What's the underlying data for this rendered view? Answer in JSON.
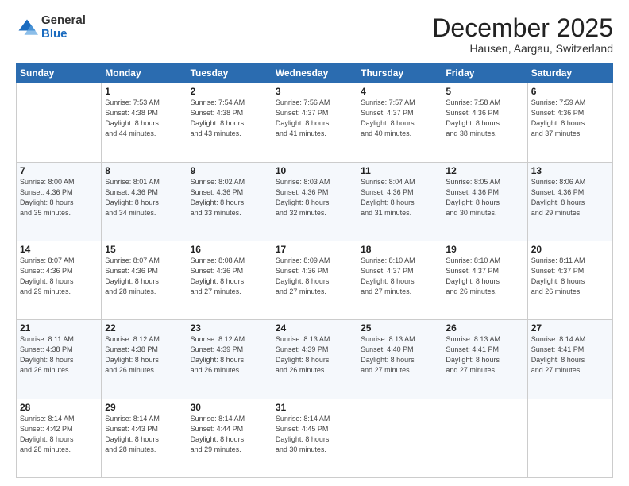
{
  "logo": {
    "general": "General",
    "blue": "Blue"
  },
  "title": "December 2025",
  "location": "Hausen, Aargau, Switzerland",
  "days_header": [
    "Sunday",
    "Monday",
    "Tuesday",
    "Wednesday",
    "Thursday",
    "Friday",
    "Saturday"
  ],
  "weeks": [
    [
      {
        "day": "",
        "info": ""
      },
      {
        "day": "1",
        "info": "Sunrise: 7:53 AM\nSunset: 4:38 PM\nDaylight: 8 hours\nand 44 minutes."
      },
      {
        "day": "2",
        "info": "Sunrise: 7:54 AM\nSunset: 4:38 PM\nDaylight: 8 hours\nand 43 minutes."
      },
      {
        "day": "3",
        "info": "Sunrise: 7:56 AM\nSunset: 4:37 PM\nDaylight: 8 hours\nand 41 minutes."
      },
      {
        "day": "4",
        "info": "Sunrise: 7:57 AM\nSunset: 4:37 PM\nDaylight: 8 hours\nand 40 minutes."
      },
      {
        "day": "5",
        "info": "Sunrise: 7:58 AM\nSunset: 4:36 PM\nDaylight: 8 hours\nand 38 minutes."
      },
      {
        "day": "6",
        "info": "Sunrise: 7:59 AM\nSunset: 4:36 PM\nDaylight: 8 hours\nand 37 minutes."
      }
    ],
    [
      {
        "day": "7",
        "info": "Sunrise: 8:00 AM\nSunset: 4:36 PM\nDaylight: 8 hours\nand 35 minutes."
      },
      {
        "day": "8",
        "info": "Sunrise: 8:01 AM\nSunset: 4:36 PM\nDaylight: 8 hours\nand 34 minutes."
      },
      {
        "day": "9",
        "info": "Sunrise: 8:02 AM\nSunset: 4:36 PM\nDaylight: 8 hours\nand 33 minutes."
      },
      {
        "day": "10",
        "info": "Sunrise: 8:03 AM\nSunset: 4:36 PM\nDaylight: 8 hours\nand 32 minutes."
      },
      {
        "day": "11",
        "info": "Sunrise: 8:04 AM\nSunset: 4:36 PM\nDaylight: 8 hours\nand 31 minutes."
      },
      {
        "day": "12",
        "info": "Sunrise: 8:05 AM\nSunset: 4:36 PM\nDaylight: 8 hours\nand 30 minutes."
      },
      {
        "day": "13",
        "info": "Sunrise: 8:06 AM\nSunset: 4:36 PM\nDaylight: 8 hours\nand 29 minutes."
      }
    ],
    [
      {
        "day": "14",
        "info": "Sunrise: 8:07 AM\nSunset: 4:36 PM\nDaylight: 8 hours\nand 29 minutes."
      },
      {
        "day": "15",
        "info": "Sunrise: 8:07 AM\nSunset: 4:36 PM\nDaylight: 8 hours\nand 28 minutes."
      },
      {
        "day": "16",
        "info": "Sunrise: 8:08 AM\nSunset: 4:36 PM\nDaylight: 8 hours\nand 27 minutes."
      },
      {
        "day": "17",
        "info": "Sunrise: 8:09 AM\nSunset: 4:36 PM\nDaylight: 8 hours\nand 27 minutes."
      },
      {
        "day": "18",
        "info": "Sunrise: 8:10 AM\nSunset: 4:37 PM\nDaylight: 8 hours\nand 27 minutes."
      },
      {
        "day": "19",
        "info": "Sunrise: 8:10 AM\nSunset: 4:37 PM\nDaylight: 8 hours\nand 26 minutes."
      },
      {
        "day": "20",
        "info": "Sunrise: 8:11 AM\nSunset: 4:37 PM\nDaylight: 8 hours\nand 26 minutes."
      }
    ],
    [
      {
        "day": "21",
        "info": "Sunrise: 8:11 AM\nSunset: 4:38 PM\nDaylight: 8 hours\nand 26 minutes."
      },
      {
        "day": "22",
        "info": "Sunrise: 8:12 AM\nSunset: 4:38 PM\nDaylight: 8 hours\nand 26 minutes."
      },
      {
        "day": "23",
        "info": "Sunrise: 8:12 AM\nSunset: 4:39 PM\nDaylight: 8 hours\nand 26 minutes."
      },
      {
        "day": "24",
        "info": "Sunrise: 8:13 AM\nSunset: 4:39 PM\nDaylight: 8 hours\nand 26 minutes."
      },
      {
        "day": "25",
        "info": "Sunrise: 8:13 AM\nSunset: 4:40 PM\nDaylight: 8 hours\nand 27 minutes."
      },
      {
        "day": "26",
        "info": "Sunrise: 8:13 AM\nSunset: 4:41 PM\nDaylight: 8 hours\nand 27 minutes."
      },
      {
        "day": "27",
        "info": "Sunrise: 8:14 AM\nSunset: 4:41 PM\nDaylight: 8 hours\nand 27 minutes."
      }
    ],
    [
      {
        "day": "28",
        "info": "Sunrise: 8:14 AM\nSunset: 4:42 PM\nDaylight: 8 hours\nand 28 minutes."
      },
      {
        "day": "29",
        "info": "Sunrise: 8:14 AM\nSunset: 4:43 PM\nDaylight: 8 hours\nand 28 minutes."
      },
      {
        "day": "30",
        "info": "Sunrise: 8:14 AM\nSunset: 4:44 PM\nDaylight: 8 hours\nand 29 minutes."
      },
      {
        "day": "31",
        "info": "Sunrise: 8:14 AM\nSunset: 4:45 PM\nDaylight: 8 hours\nand 30 minutes."
      },
      {
        "day": "",
        "info": ""
      },
      {
        "day": "",
        "info": ""
      },
      {
        "day": "",
        "info": ""
      }
    ]
  ]
}
